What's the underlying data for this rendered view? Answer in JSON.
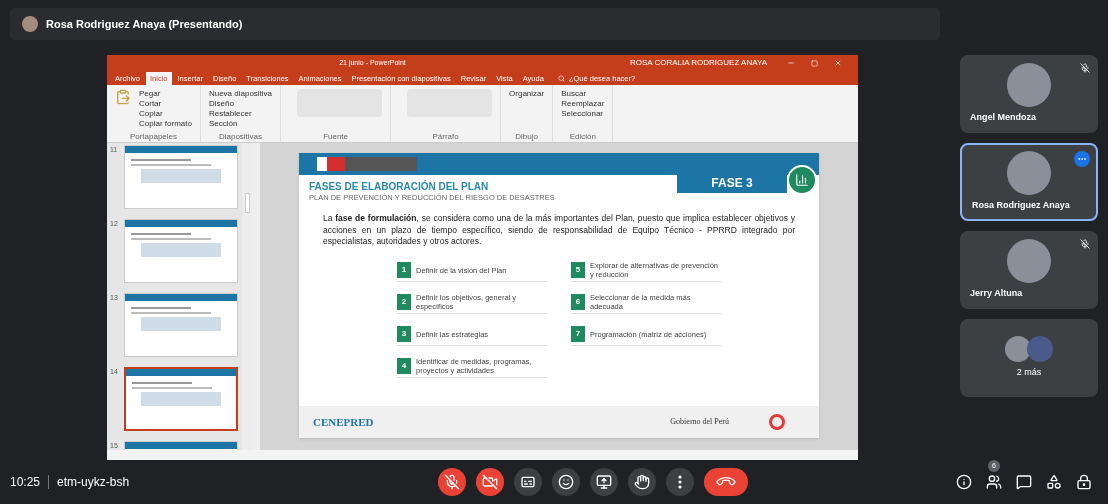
{
  "presenter_bar": {
    "title": "Rosa Rodriguez Anaya (Presentando)"
  },
  "powerpoint": {
    "title": "21 junio - PowerPoint",
    "user": "ROSA CORALIA RODRIGUEZ ANAYA",
    "tabs": [
      {
        "label": "Archivo",
        "selected": false
      },
      {
        "label": "Inicio",
        "selected": true
      },
      {
        "label": "Insertar",
        "selected": false
      },
      {
        "label": "Diseño",
        "selected": false
      },
      {
        "label": "Transiciones",
        "selected": false
      },
      {
        "label": "Animaciones",
        "selected": false
      },
      {
        "label": "Presentación con diapositivas",
        "selected": false
      },
      {
        "label": "Revisar",
        "selected": false
      },
      {
        "label": "Vista",
        "selected": false
      },
      {
        "label": "Ayuda",
        "selected": false
      }
    ],
    "tell_me": "¿Qué desea hacer?",
    "ribbon_groups": [
      {
        "label": "Portapapeles",
        "items": [
          "Pegar",
          "Cortar",
          "Copiar",
          "Copiar formato"
        ]
      },
      {
        "label": "Diapositivas",
        "items": [
          "Nueva diapositiva",
          "Diseño",
          "Restablecer",
          "Sección"
        ]
      },
      {
        "label": "Fuente"
      },
      {
        "label": "Párrafo"
      },
      {
        "label": "Dibujo",
        "items": [
          "Organizar"
        ]
      },
      {
        "label": "Edición",
        "items": [
          "Buscar",
          "Reemplazar",
          "Seleccionar"
        ]
      }
    ],
    "thumbnails": [
      {
        "number": "11",
        "selected": false
      },
      {
        "number": "12",
        "selected": false
      },
      {
        "number": "13",
        "selected": false
      },
      {
        "number": "14",
        "selected": true
      },
      {
        "number": "15",
        "selected": false
      }
    ],
    "slide": {
      "title": "FASES DE ELABORACIÓN DEL PLAN",
      "subtitle": "PLAN DE PREVENCIÓN Y REDUCCIÓN DEL RIESGO DE DESASTRES",
      "phase": "FASE 3",
      "paragraph": "La **fase de formulación**, se considera como una de la más importantes del Plan, puesto que implica establecer objetivos y acciones en un plazo de tiempo específico, siendo de responsabilidad de Equipo Técnico - PPRRD integrado por especialistas, autoridades y otros actores.",
      "steps": [
        {
          "number": "1",
          "text": "Definir de la visión del Plan"
        },
        {
          "number": "2",
          "text": "Definir los objetivos, general y específicos"
        },
        {
          "number": "3",
          "text": "Definir las estrategias"
        },
        {
          "number": "4",
          "text": "Identificar de medidas, programas, proyectos y actividades"
        },
        {
          "number": "5",
          "text": "Explorar de alternativas de prevención y reducción"
        },
        {
          "number": "6",
          "text": "Seleccionar de la medida más adecuada"
        },
        {
          "number": "7",
          "text": "Programación (matriz de acciones)"
        }
      ],
      "footer_logo": "CENEPRED",
      "footer_government": "Gobierno del Perú"
    }
  },
  "participants": [
    {
      "kind": "person",
      "name": "Angel Mendoza",
      "muted": true,
      "selected": false
    },
    {
      "kind": "person",
      "name": "Rosa Rodriguez Anaya",
      "muted": false,
      "selected": true
    },
    {
      "kind": "person",
      "name": "Jerry Altuna",
      "muted": true,
      "selected": false
    },
    {
      "kind": "more",
      "name": "2 más",
      "muted": false,
      "selected": false
    }
  ],
  "bottom_bar": {
    "time": "10:25",
    "meeting_code": "etm-uykz-bsh",
    "controls": [
      {
        "kind": "mic",
        "on": false
      },
      {
        "kind": "camera",
        "on": false
      },
      {
        "kind": "captions"
      },
      {
        "kind": "emoji"
      },
      {
        "kind": "present"
      },
      {
        "kind": "hand"
      },
      {
        "kind": "more"
      },
      {
        "kind": "hangup"
      }
    ],
    "people_count": "6"
  }
}
